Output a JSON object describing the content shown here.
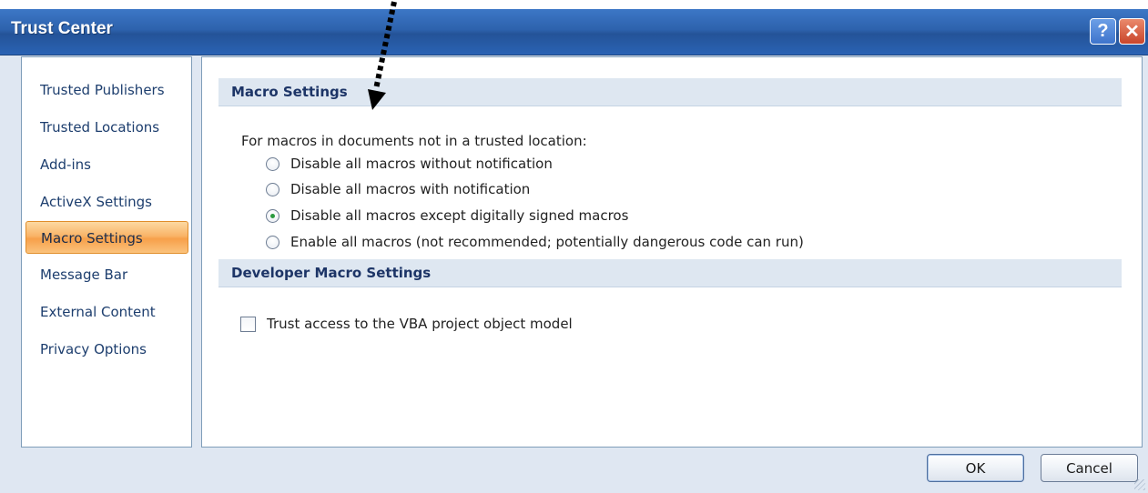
{
  "window": {
    "title": "Trust Center",
    "help_glyph": "?",
    "close_glyph": "✕"
  },
  "sidebar": {
    "items": [
      {
        "label": "Trusted Publishers",
        "active": false
      },
      {
        "label": "Trusted Locations",
        "active": false
      },
      {
        "label": "Add-ins",
        "active": false
      },
      {
        "label": "ActiveX Settings",
        "active": false
      },
      {
        "label": "Macro Settings",
        "active": true
      },
      {
        "label": "Message Bar",
        "active": false
      },
      {
        "label": "External Content",
        "active": false
      },
      {
        "label": "Privacy Options",
        "active": false
      }
    ]
  },
  "macro_settings": {
    "header": "Macro Settings",
    "intro": "For macros in documents not in a trusted location:",
    "options": [
      {
        "label": "Disable all macros without notification",
        "selected": false
      },
      {
        "label": "Disable all macros with notification",
        "selected": false
      },
      {
        "label": "Disable all macros except digitally signed macros",
        "selected": true
      },
      {
        "label": "Enable all macros (not recommended; potentially dangerous code can run)",
        "selected": false
      }
    ]
  },
  "developer_settings": {
    "header": "Developer Macro Settings",
    "vba_access_label": "Trust access to the VBA project object model",
    "vba_access_checked": false
  },
  "buttons": {
    "ok": "OK",
    "cancel": "Cancel"
  },
  "colors": {
    "titlebar": "#2a63b4",
    "active_nav": "#f7a04a",
    "section_header": "#dee7f1",
    "radio_dot": "#2b9a3f"
  }
}
